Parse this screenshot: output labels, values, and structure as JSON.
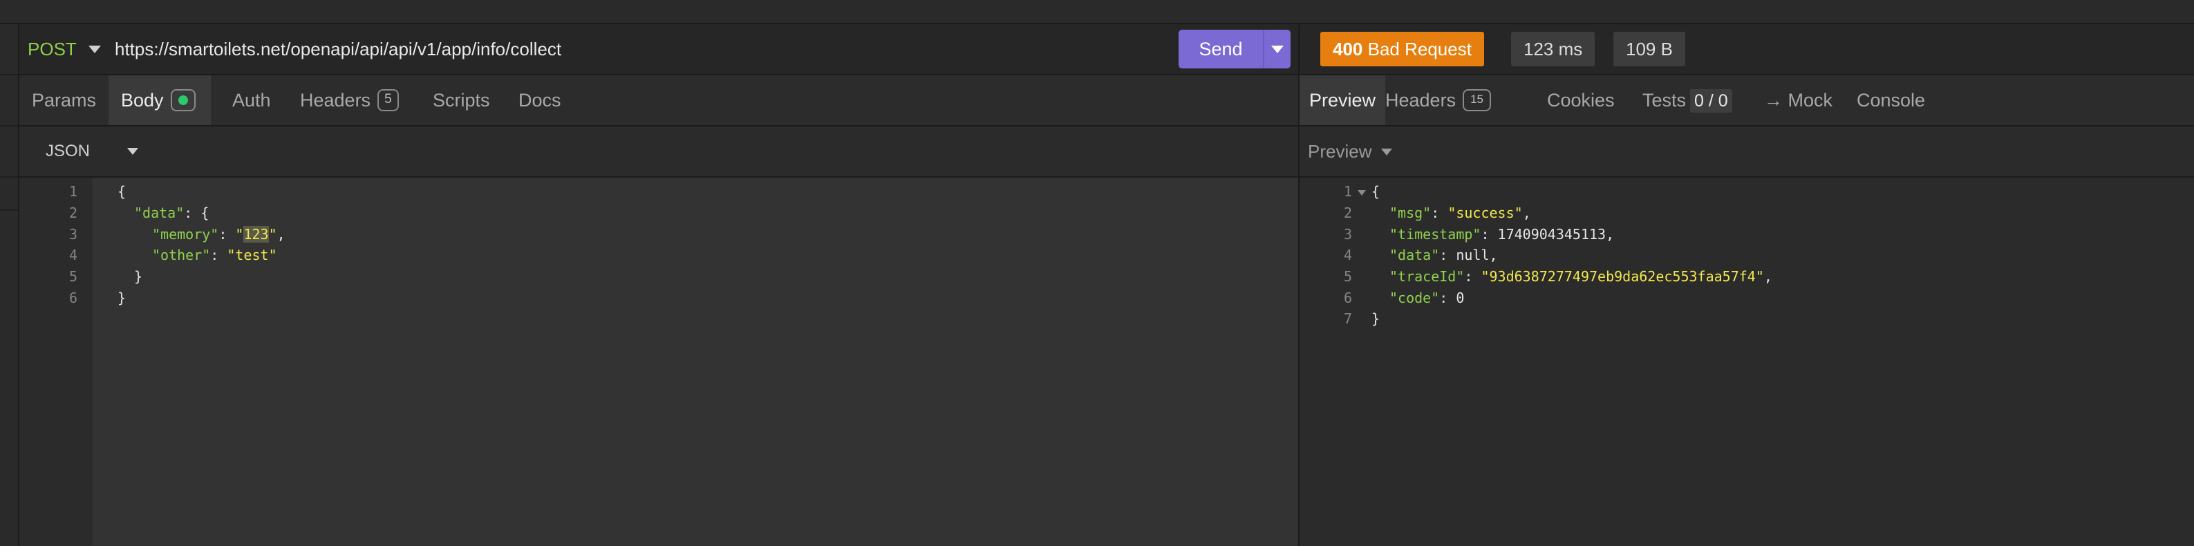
{
  "request": {
    "method": "POST",
    "url": "https://smartoilets.net/openapi/api/api/v1/app/info/collect",
    "send_label": "Send",
    "tabs": [
      {
        "label": "Params"
      },
      {
        "label": "Body",
        "active": true
      },
      {
        "label": "Auth"
      },
      {
        "label": "Headers",
        "count": "5"
      },
      {
        "label": "Scripts"
      },
      {
        "label": "Docs"
      }
    ],
    "body_type": "JSON",
    "body_lines": [
      {
        "n": "1"
      },
      {
        "n": "2"
      },
      {
        "n": "3"
      },
      {
        "n": "4"
      },
      {
        "n": "5"
      },
      {
        "n": "6"
      }
    ],
    "body_text": {
      "l1": "{",
      "l2_key": "\"data\"",
      "l2_rest": ": {",
      "l3_key": "\"memory\"",
      "l3_colon": ": ",
      "l3_q1": "\"",
      "l3_val": "123",
      "l3_q2": "\"",
      "l3_comma": ",",
      "l4_key": "\"other\"",
      "l4_colon": ": ",
      "l4_val": "\"test\"",
      "l5": "}",
      "l6": "}"
    }
  },
  "response": {
    "status_code": "400",
    "status_text": "Bad Request",
    "time": "123 ms",
    "size": "109 B",
    "tabs": {
      "preview": "Preview",
      "headers": "Headers",
      "headers_count": "15",
      "cookies": "Cookies",
      "tests": "Tests",
      "tests_score": "0 / 0",
      "mock": "→ Mock",
      "console": "Console"
    },
    "preview_label": "Preview",
    "lines": {
      "n1": "1",
      "n2": "2",
      "n3": "3",
      "n4": "4",
      "n5": "5",
      "n6": "6",
      "n7": "7",
      "l1": "{",
      "l2_key": "\"msg\"",
      "l2_colon": ": ",
      "l2_val": "\"success\"",
      "l2_comma": ",",
      "l3_key": "\"timestamp\"",
      "l3_rest": ": 1740904345113,",
      "l4_key": "\"data\"",
      "l4_rest": ": null,",
      "l5_key": "\"traceId\"",
      "l5_colon": ": ",
      "l5_val": "\"93d6387277497eb9da62ec553faa57f4\"",
      "l5_comma": ",",
      "l6_key": "\"code\"",
      "l6_rest": ": 0",
      "l7": "}"
    }
  },
  "colors": {
    "accent_send": "#7b6ad4",
    "status_error": "#e67f0f",
    "method_post": "#8ed04a",
    "json_key": "#90d14c",
    "json_string": "#f2e84b"
  }
}
